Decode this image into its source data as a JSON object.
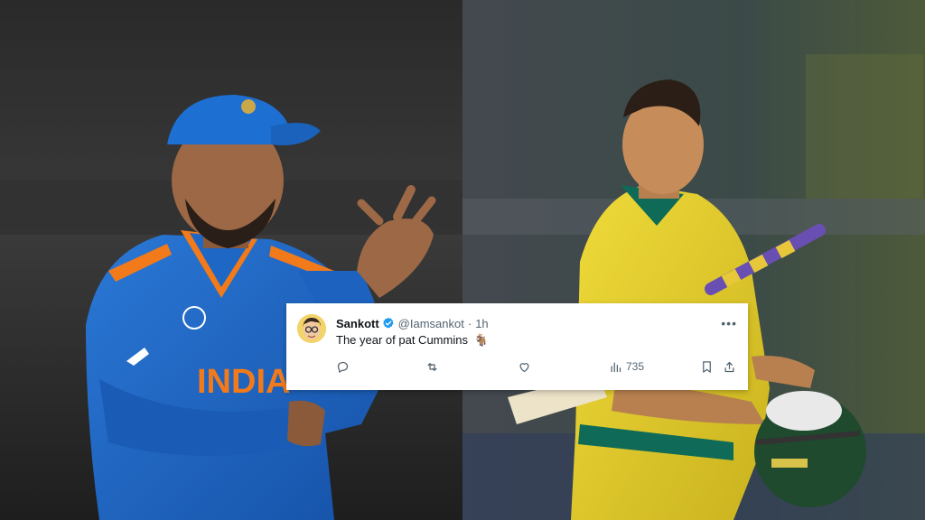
{
  "tweet": {
    "author_name": "Sankott",
    "handle": "@Iamsankot",
    "separator": "·",
    "time": "1h",
    "text": "The year of pat Cummins",
    "emoji": "🐐",
    "views": "735",
    "icons": [
      "reply-icon",
      "retweet-icon",
      "like-icon",
      "views-icon",
      "bookmark-icon",
      "share-icon",
      "more-icon",
      "verified-badge-icon"
    ],
    "accent_color": "#1d9bf0"
  },
  "photo_left": {
    "jersey_text": "INDIA",
    "colors": {
      "jersey": "#1f67c4",
      "cap": "#1d6fd1",
      "accent": "#f27a1a"
    }
  },
  "photo_right": {
    "colors": {
      "jersey": "#e8d22a",
      "trim": "#0f6b57"
    }
  }
}
